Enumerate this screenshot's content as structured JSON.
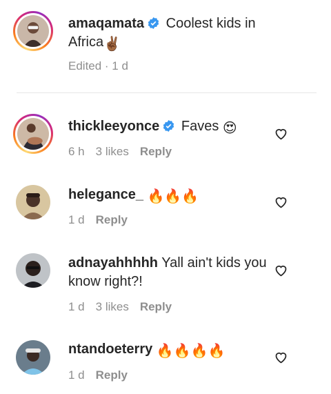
{
  "caption": {
    "username": "amaqamata",
    "text": "Coolest kids in Africa",
    "emoji": "✌🏾",
    "edited_label": "Edited · 1 d"
  },
  "comments": [
    {
      "username": "thickleeyonce",
      "verified": true,
      "text": "Faves",
      "emoji": "😍",
      "time": "6 h",
      "likes": "3 likes",
      "reply": "Reply"
    },
    {
      "username": "helegance_",
      "verified": false,
      "text": "",
      "emoji": "🔥🔥🔥",
      "time": "1 d",
      "likes": "",
      "reply": "Reply"
    },
    {
      "username": "adnayahhhhh",
      "verified": false,
      "text": "Yall ain't kids you know right?!",
      "emoji": "",
      "time": "1 d",
      "likes": "3 likes",
      "reply": "Reply"
    },
    {
      "username": "ntandoeterry",
      "verified": false,
      "text": "",
      "emoji": "🔥🔥🔥🔥",
      "time": "1 d",
      "likes": "",
      "reply": "Reply"
    }
  ],
  "colors": {
    "verified": "#3897f0",
    "meta": "#8e8e8e",
    "text": "#262626"
  }
}
